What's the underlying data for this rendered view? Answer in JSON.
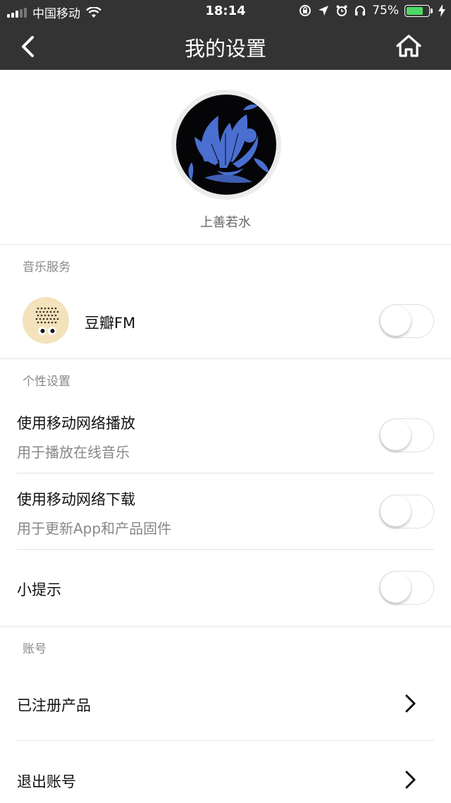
{
  "status_bar": {
    "carrier": "中国移动",
    "time": "18:14",
    "battery_percent": "75%",
    "battery_level": 0.75
  },
  "nav": {
    "title": "我的设置",
    "back_icon": "chevron-left-icon",
    "home_icon": "home-icon"
  },
  "profile": {
    "username": "上善若水"
  },
  "music_service": {
    "section_title": "音乐服务",
    "items": [
      {
        "label": "豆瓣FM",
        "enabled": false
      }
    ]
  },
  "personal": {
    "section_title": "个性设置",
    "items": [
      {
        "label": "使用移动网络播放",
        "sub": "用于播放在线音乐",
        "enabled": false
      },
      {
        "label": "使用移动网络下载",
        "sub": "用于更新App和产品固件",
        "enabled": false
      },
      {
        "label": "小提示",
        "enabled": false
      }
    ]
  },
  "account": {
    "section_title": "账号",
    "items": [
      {
        "label": "已注册产品"
      },
      {
        "label": "退出账号"
      }
    ]
  },
  "colors": {
    "header_bg": "#333333",
    "battery_fill": "#4cd964"
  }
}
